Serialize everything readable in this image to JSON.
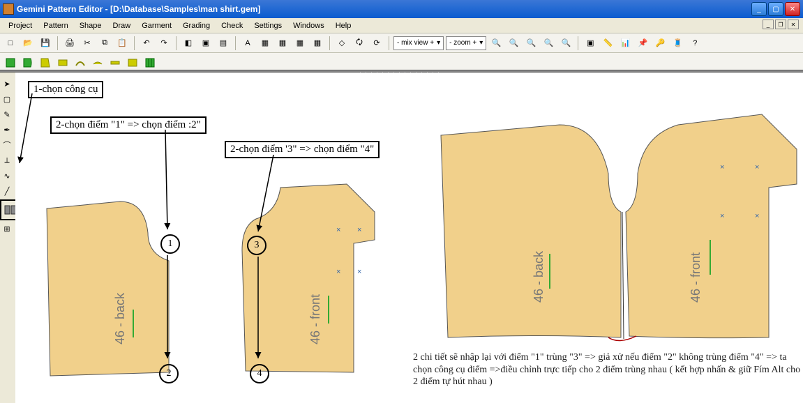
{
  "window": {
    "title": "Gemini Pattern Editor - [D:\\Database\\Samples\\man shirt.gem]"
  },
  "menu": {
    "items": [
      "Project",
      "Pattern",
      "Shape",
      "Draw",
      "Garment",
      "Grading",
      "Check",
      "Settings",
      "Windows",
      "Help"
    ]
  },
  "toolbar": {
    "mixview": "- mix view +",
    "zoom": "- zoom  +"
  },
  "sidebarTools": [
    "pointer",
    "square",
    "edit",
    "pen",
    "tool-a",
    "tool-b",
    "tool-c",
    "tool-d",
    "tool-e",
    "join-tool"
  ],
  "annotations": {
    "step1": "1-chọn công cụ",
    "step2a": "2-chọn điểm \"1\" => chọn điểm :2\"",
    "step2b": "2-chọn điểm '3\" => chọn điểm \"4\"",
    "note_right": "2 chi tiết sẽ nhập lại với điểm \"1\" trùng \"3\" => giả xử nếu điểm \"2\" không trùng điểm \"4\" => ta chọn công cụ điểm =>điều chỉnh trực tiếp cho 2 điểm trùng nhau ( kết hợp nhấn & giữ Fím Alt cho 2 điểm tự hút nhau )"
  },
  "pieces": {
    "back_label": "46 - back",
    "front_label": "46 - front"
  },
  "points": {
    "p1": "1",
    "p2": "2",
    "p3": "3",
    "p4": "4"
  },
  "icons": {
    "new": "□",
    "open": "📂",
    "save": "💾",
    "print": "🖨",
    "undo": "↶",
    "redo": "↷",
    "text": "A",
    "grid": "▦",
    "search": "🔍"
  }
}
